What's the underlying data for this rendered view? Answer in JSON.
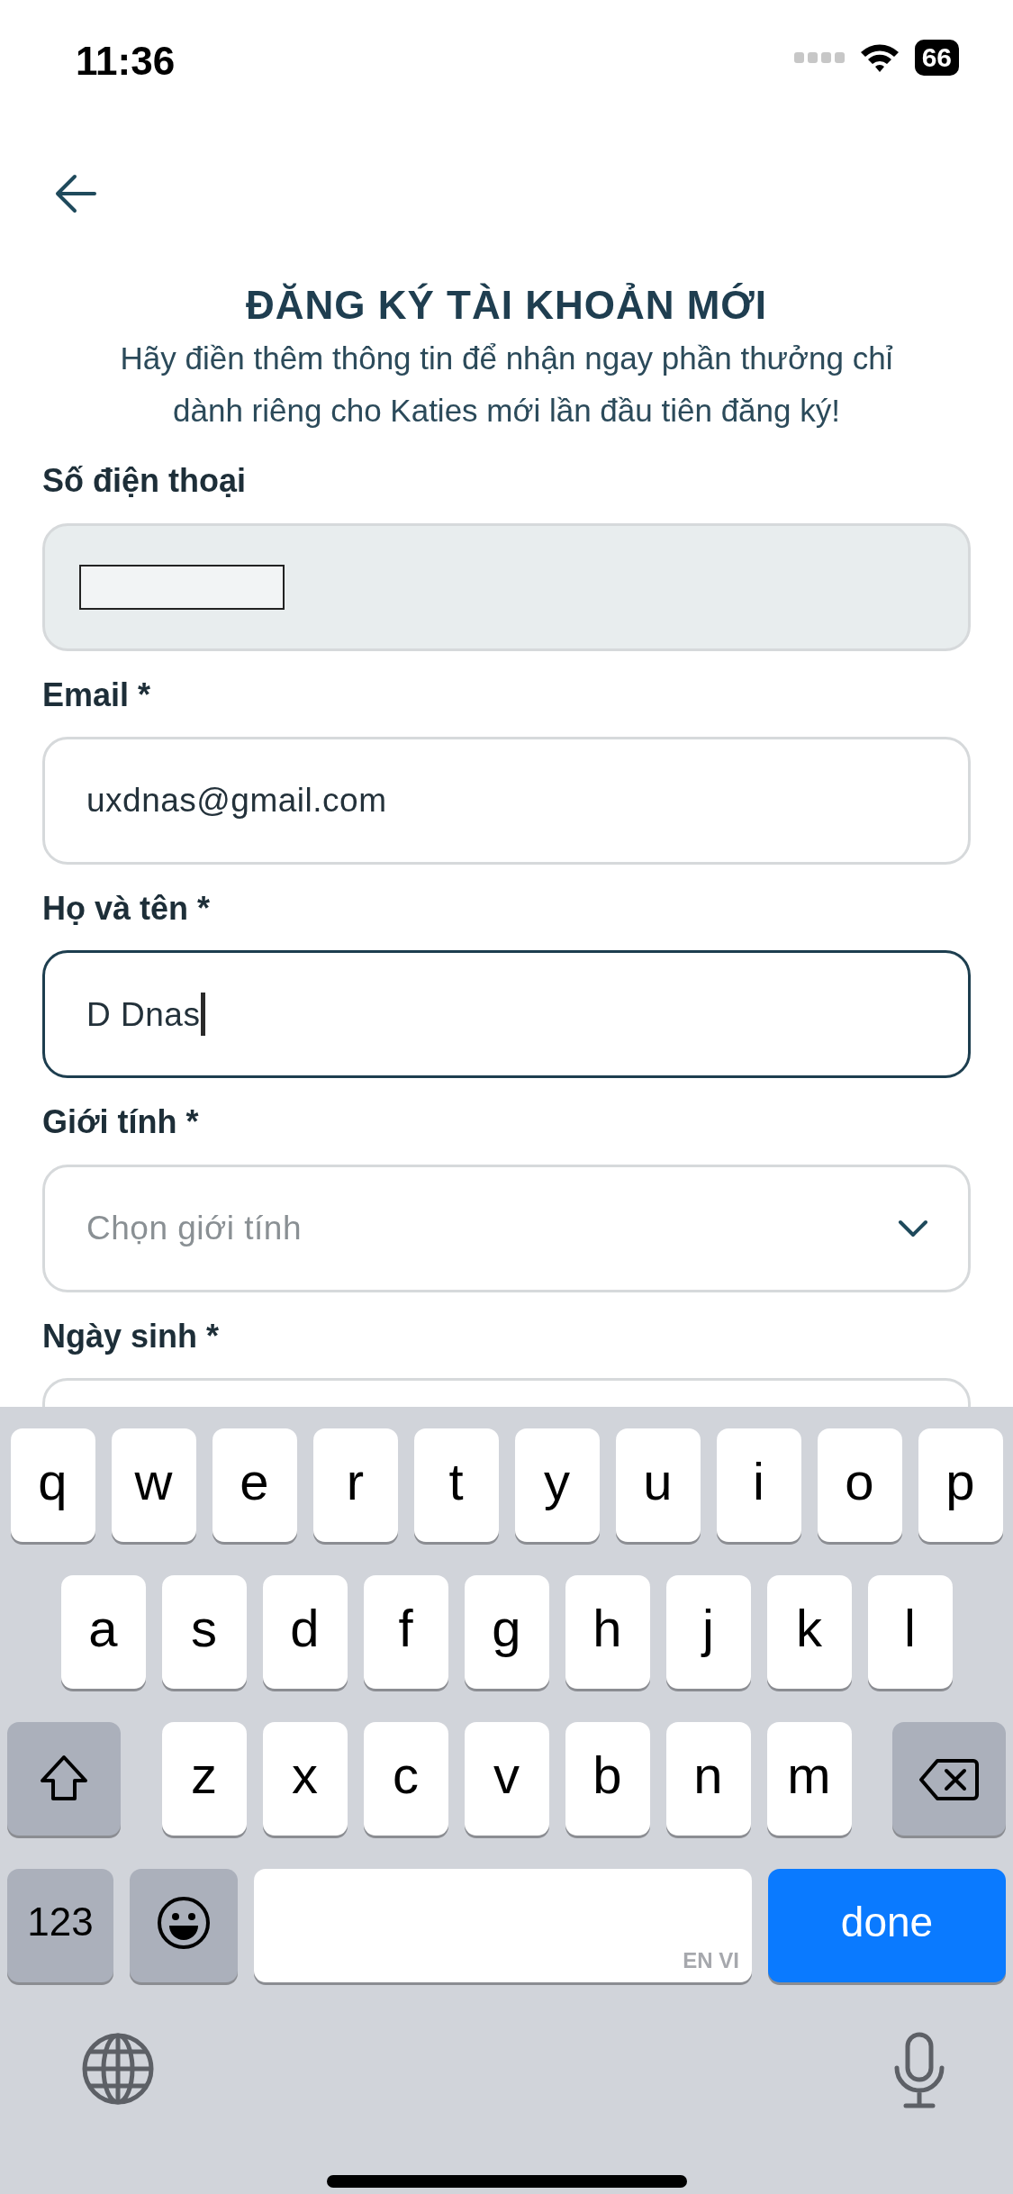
{
  "status_bar": {
    "time": "11:36",
    "battery": "66"
  },
  "header": {
    "title": "ĐĂNG KÝ TÀI KHOẢN MỚI",
    "subtitle": "Hãy điền thêm thông tin để nhận ngay phần thưởng chỉ dành riêng cho Katies mới lần đầu tiên đăng ký!"
  },
  "fields": [
    {
      "kind": "redacted",
      "label": "Số điện thoại",
      "disabled": true,
      "focused": false
    },
    {
      "kind": "text",
      "label": "Email *",
      "value": "uxdnas@gmail.com",
      "disabled": false,
      "focused": false
    },
    {
      "kind": "text",
      "label": "Họ và tên *",
      "value": "D Dnas",
      "disabled": false,
      "focused": true
    },
    {
      "kind": "select",
      "label": "Giới tính *",
      "placeholder": "Chọn giới tính",
      "disabled": false,
      "focused": false
    },
    {
      "kind": "cut",
      "label": "Ngày sinh *"
    }
  ],
  "keyboard": {
    "rows": [
      [
        "q",
        "w",
        "e",
        "r",
        "t",
        "y",
        "u",
        "i",
        "o",
        "p"
      ],
      [
        "a",
        "s",
        "d",
        "f",
        "g",
        "h",
        "j",
        "k",
        "l"
      ],
      [
        "z",
        "x",
        "c",
        "v",
        "b",
        "n",
        "m"
      ]
    ],
    "numbers_key": "123",
    "space_hint": "EN VI",
    "return_key": "done"
  }
}
